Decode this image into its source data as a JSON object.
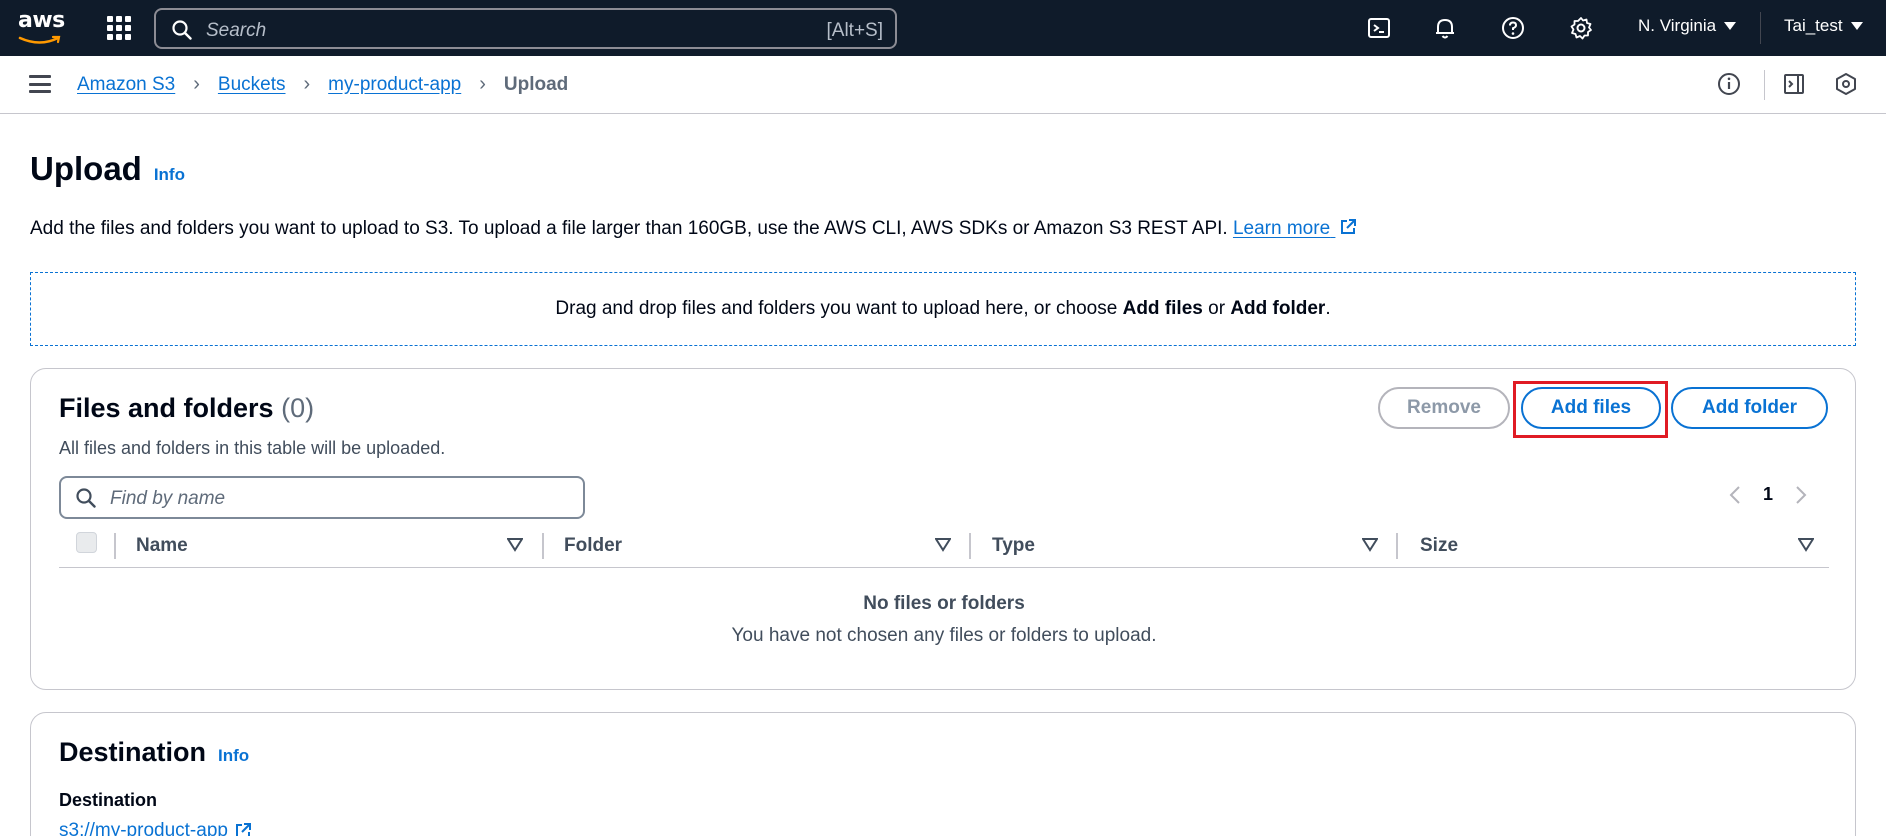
{
  "topnav": {
    "logo_text": "aws",
    "search_placeholder": "Search",
    "search_shortcut": "[Alt+S]",
    "region": "N. Virginia",
    "account": "Tai_test",
    "icons": [
      "cloudshell-icon",
      "bell-icon",
      "help-icon",
      "settings-icon"
    ],
    "background": "#0f1b2a"
  },
  "breadcrumb": {
    "items": [
      "Amazon S3",
      "Buckets",
      "my-product-app"
    ],
    "current": "Upload"
  },
  "page": {
    "title": "Upload",
    "info": "Info",
    "description": "Add the files and folders you want to upload to S3. To upload a file larger than 160GB, use the AWS CLI, AWS SDKs or Amazon S3 REST API.",
    "learn_more": "Learn more"
  },
  "dropzone": {
    "text_before": "Drag and drop files and folders you want to upload here, or choose",
    "add_files": "Add files",
    "or": "or",
    "add_folder": "Add folder",
    "period": "."
  },
  "files_panel": {
    "title": "Files and folders",
    "count": "(0)",
    "subtitle": "All files and folders in this table will be uploaded.",
    "buttons": {
      "remove": "Remove",
      "add_files": "Add files",
      "add_folder": "Add folder"
    },
    "filter_placeholder": "Find by name",
    "page_number": "1",
    "columns": [
      "Name",
      "Folder",
      "Type",
      "Size"
    ],
    "empty_title": "No files or folders",
    "empty_subtitle": "You have not chosen any files or folders to upload."
  },
  "destination_panel": {
    "title": "Destination",
    "info": "Info",
    "label": "Destination",
    "link": "s3://my-product-app"
  },
  "colors": {
    "link": "#0972d3",
    "highlight": "#e01b24",
    "text": "#000716"
  }
}
